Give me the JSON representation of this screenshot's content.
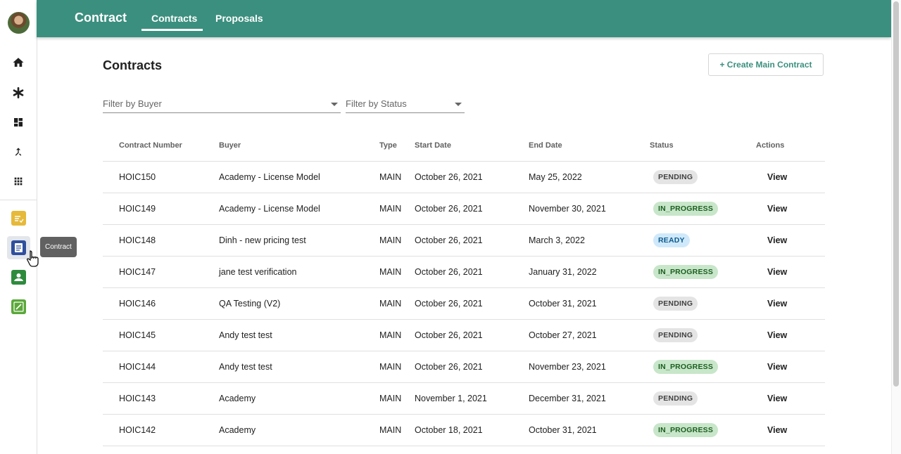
{
  "app": {
    "title": "Contract"
  },
  "tabs": [
    {
      "label": "Contracts",
      "active": true
    },
    {
      "label": "Proposals",
      "active": false
    }
  ],
  "nav": {
    "icons": [
      "home-icon",
      "asterisk-icon",
      "dashboard-icon",
      "merge-icon",
      "apps-grid-icon"
    ],
    "apps": [
      {
        "name": "tasks-app-icon",
        "color": "#e6b93a"
      },
      {
        "name": "contract-app-icon",
        "color": "#2f4f9e"
      },
      {
        "name": "people-app-icon",
        "color": "#2e8b3d"
      },
      {
        "name": "edit-app-icon",
        "color": "#5aa83a"
      }
    ],
    "tooltip": "Contract"
  },
  "page": {
    "title": "Contracts",
    "create_label": "+ Create Main Contract"
  },
  "filters": {
    "buyer_placeholder": "Filter by Buyer",
    "status_placeholder": "Filter by Status"
  },
  "table": {
    "headers": [
      "Contract Number",
      "Buyer",
      "Type",
      "Start Date",
      "End Date",
      "Status",
      "Actions"
    ],
    "rows": [
      {
        "number": "HOIC150",
        "buyer": "Academy - License Model",
        "type": "MAIN",
        "start": "October 26, 2021",
        "end": "May 25, 2022",
        "status": "PENDING",
        "action": "View"
      },
      {
        "number": "HOIC149",
        "buyer": "Academy - License Model",
        "type": "MAIN",
        "start": "October 26, 2021",
        "end": "November 30, 2021",
        "status": "IN_PROGRESS",
        "action": "View"
      },
      {
        "number": "HOIC148",
        "buyer": "Dinh - new pricing test",
        "type": "MAIN",
        "start": "October 26, 2021",
        "end": "March 3, 2022",
        "status": "READY",
        "action": "View"
      },
      {
        "number": "HOIC147",
        "buyer": "jane test verification",
        "type": "MAIN",
        "start": "October 26, 2021",
        "end": "January 31, 2022",
        "status": "IN_PROGRESS",
        "action": "View"
      },
      {
        "number": "HOIC146",
        "buyer": "QA Testing (V2)",
        "type": "MAIN",
        "start": "October 26, 2021",
        "end": "October 31, 2021",
        "status": "PENDING",
        "action": "View"
      },
      {
        "number": "HOIC145",
        "buyer": "Andy test test",
        "type": "MAIN",
        "start": "October 26, 2021",
        "end": "October 27, 2021",
        "status": "PENDING",
        "action": "View"
      },
      {
        "number": "HOIC144",
        "buyer": "Andy test test",
        "type": "MAIN",
        "start": "October 26, 2021",
        "end": "November 23, 2021",
        "status": "IN_PROGRESS",
        "action": "View"
      },
      {
        "number": "HOIC143",
        "buyer": "Academy",
        "type": "MAIN",
        "start": "November 1, 2021",
        "end": "December 31, 2021",
        "status": "PENDING",
        "action": "View"
      },
      {
        "number": "HOIC142",
        "buyer": "Academy",
        "type": "MAIN",
        "start": "October 18, 2021",
        "end": "October 31, 2021",
        "status": "IN_PROGRESS",
        "action": "View"
      }
    ]
  },
  "status_colors": {
    "PENDING": {
      "bg": "#e4e4e4",
      "fg": "#424242"
    },
    "IN_PROGRESS": {
      "bg": "#c8e6c9",
      "fg": "#1b5e20"
    },
    "READY": {
      "bg": "#cfe9fb",
      "fg": "#0d5a8c"
    }
  },
  "colors": {
    "primary": "#3b8f7e"
  }
}
